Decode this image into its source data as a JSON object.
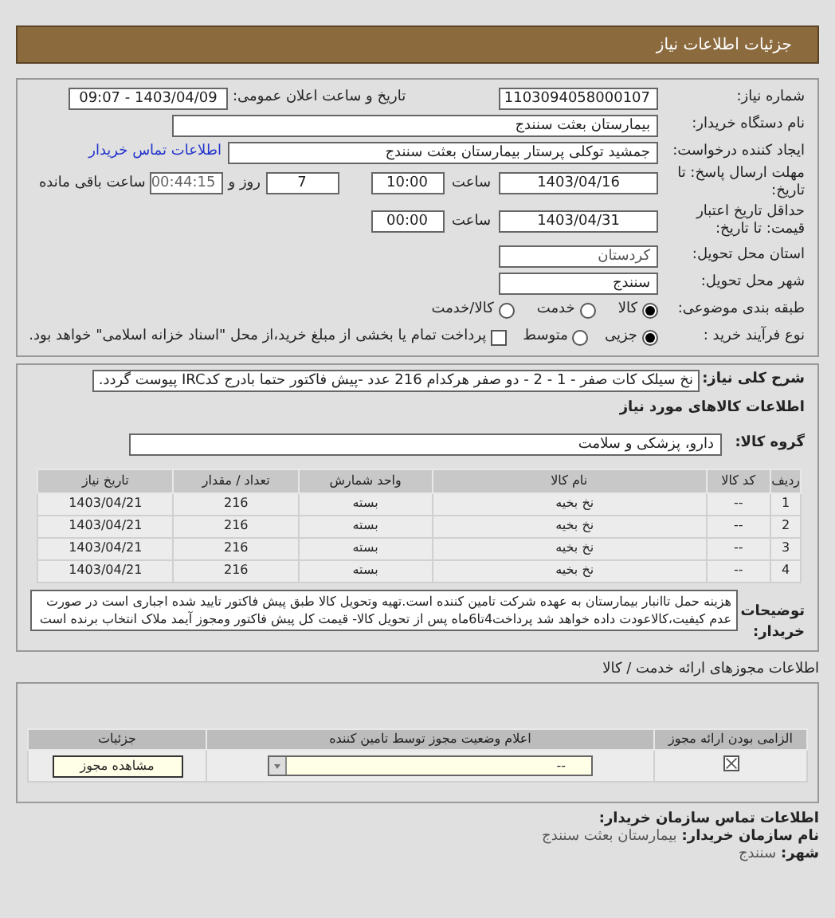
{
  "header": {
    "title": "جزئیات اطلاعات نیاز"
  },
  "details": {
    "need_number": {
      "label": "شماره نیاز:",
      "value": "1103094058000107"
    },
    "announce": {
      "label": "تاریخ و ساعت اعلان عمومی:",
      "value": "1403/04/09 - 09:07"
    },
    "buyer": {
      "label": "نام دستگاه خریدار:",
      "value": "بیمارستان بعثت سنندج"
    },
    "requester": {
      "label": "ایجاد کننده درخواست:",
      "value": "جمشید  توکلی پرستار بیمارستان بعثت سنندج",
      "link": "اطلاعات تماس خریدار"
    },
    "deadline": {
      "label": "مهلت ارسال پاسخ: تا تاریخ:",
      "date": "1403/04/16",
      "time_label": "ساعت",
      "time": "10:00",
      "days": "7",
      "days_label": "روز و",
      "remaining": "00:44:15",
      "remaining_label": "ساعت باقی مانده"
    },
    "validity": {
      "label": "حداقل تاریخ اعتبار قیمت: تا تاریخ:",
      "date": "1403/04/31",
      "time_label": "ساعت",
      "time": "00:00"
    },
    "province": {
      "label": "استان محل تحویل:",
      "value": "کردستان"
    },
    "city": {
      "label": "شهر محل تحویل:",
      "value": "سنندج"
    },
    "category": {
      "label": "طبقه بندی موضوعی:",
      "options": [
        {
          "label": "کالا",
          "selected": true
        },
        {
          "label": "خدمت",
          "selected": false
        },
        {
          "label": "کالا/خدمت",
          "selected": false
        }
      ]
    },
    "process": {
      "label": "نوع فرآیند خرید :",
      "options": [
        {
          "label": "جزیی",
          "selected": true
        },
        {
          "label": "متوسط",
          "selected": false
        }
      ],
      "treasury": {
        "checked": false,
        "label": "پرداخت تمام یا بخشی از مبلغ خرید،از محل \"اسناد خزانه اسلامی\" خواهد بود."
      }
    }
  },
  "summary": {
    "label": "شرح کلی نیاز:",
    "value": "نخ سیلک کات صفر - 1 - 2 - دو صفر هرکدام 216 عدد -پیش فاکتور حتما بادرج کدIRC پیوست گردد."
  },
  "items_title": "اطلاعات کالاهای مورد نیاز",
  "group": {
    "label": "گروه کالا:",
    "value": "دارو، پزشکی و سلامت"
  },
  "table": {
    "columns": [
      "ردیف",
      "کد کالا",
      "نام کالا",
      "واحد شمارش",
      "تعداد / مقدار",
      "تاریخ نیاز"
    ],
    "rows": [
      [
        "1",
        "--",
        "نخ بخیه",
        "بسته",
        "216",
        "1403/04/21"
      ],
      [
        "2",
        "--",
        "نخ بخیه",
        "بسته",
        "216",
        "1403/04/21"
      ],
      [
        "3",
        "--",
        "نخ بخیه",
        "بسته",
        "216",
        "1403/04/21"
      ],
      [
        "4",
        "--",
        "نخ بخیه",
        "بسته",
        "216",
        "1403/04/21"
      ]
    ]
  },
  "buyer_notes": {
    "label": "توضیحات خریدار:",
    "value": "هزینه حمل تاانبار بیمارستان به عهده شرکت تامین کننده است.تهیه وتحویل کالا طبق پیش فاکتور تایید شده اجباری است در صورت عدم کیفیت،کالاعودت داده خواهد شد پرداخت4تا6ماه پس از تحویل کالا- قیمت کل پیش فاکتور ومجوز آیمد ملاک انتخاب برنده است"
  },
  "permits": {
    "title": "اطلاعات مجوزهای ارائه خدمت / کالا",
    "columns": [
      "الزامی بودن ارائه مجوز",
      "اعلام وضعیت مجوز توسط تامین کننده",
      "جزئیات"
    ],
    "rows": [
      {
        "required": true,
        "status": "--",
        "button": "مشاهده مجوز"
      }
    ]
  },
  "contact": {
    "title": "اطلاعات تماس سازمان خریدار:",
    "lines": [
      {
        "label": "نام سازمان خریدار:",
        "value": "بیمارستان بعثت سنندج"
      },
      {
        "label": "شهر:",
        "value": "سنندج"
      }
    ]
  }
}
